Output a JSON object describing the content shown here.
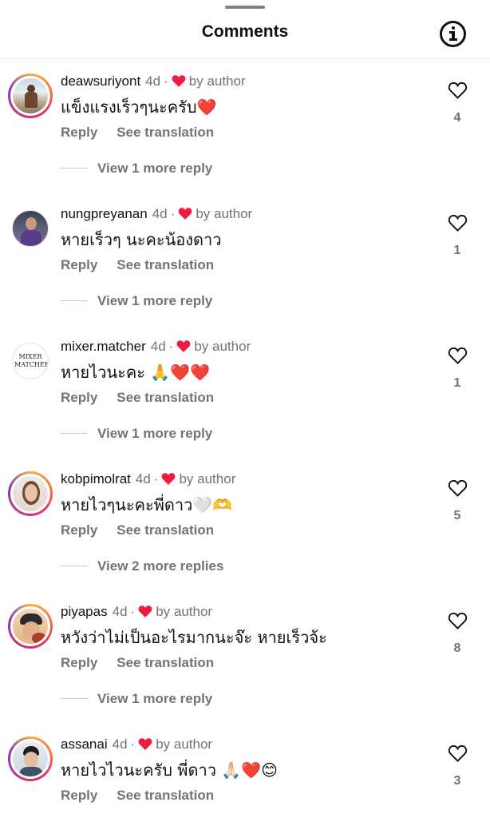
{
  "header": {
    "title": "Comments",
    "info_icon": "info-circle-icon"
  },
  "colors": {
    "heart_red": "#ed1c40",
    "muted_text": "#737373"
  },
  "comments": [
    {
      "username": "deawsuriyont",
      "time": "4d",
      "author_label": "by author",
      "text": "แข็งแรงเร็วๆนะครับ❤️",
      "reply_label": "Reply",
      "translate_label": "See translation",
      "more_label": "View 1 more reply",
      "likes": "4"
    },
    {
      "username": "nungpreyanan",
      "time": "4d",
      "author_label": "by author",
      "text": "หายเร็วๆ นะคะน้องดาว",
      "reply_label": "Reply",
      "translate_label": "See translation",
      "more_label": "View 1 more reply",
      "likes": "1"
    },
    {
      "username": "mixer.matcher",
      "time": "4d",
      "author_label": "by author",
      "text": "หายไวนะคะ 🙏❤️❤️",
      "reply_label": "Reply",
      "translate_label": "See translation",
      "more_label": "View 1 more reply",
      "likes": "1",
      "avatar_text": "MIXER MATCHER"
    },
    {
      "username": "kobpimolrat",
      "time": "4d",
      "author_label": "by author",
      "text": "หายไวๆนะคะพี่ดาว🤍🫶",
      "reply_label": "Reply",
      "translate_label": "See translation",
      "more_label": "View 2 more replies",
      "likes": "5"
    },
    {
      "username": "piyapas",
      "time": "4d",
      "author_label": "by author",
      "text": "หวังว่าไม่เป็นอะไรมากนะจ๊ะ หายเร็วจ้ะ",
      "reply_label": "Reply",
      "translate_label": "See translation",
      "more_label": "View 1 more reply",
      "likes": "8"
    },
    {
      "username": "assanai",
      "time": "4d",
      "author_label": "by author",
      "text": "หายไวไวนะครับ พี่ดาว 🙏🏻❤️😊",
      "reply_label": "Reply",
      "translate_label": "See translation",
      "likes": "3"
    }
  ]
}
